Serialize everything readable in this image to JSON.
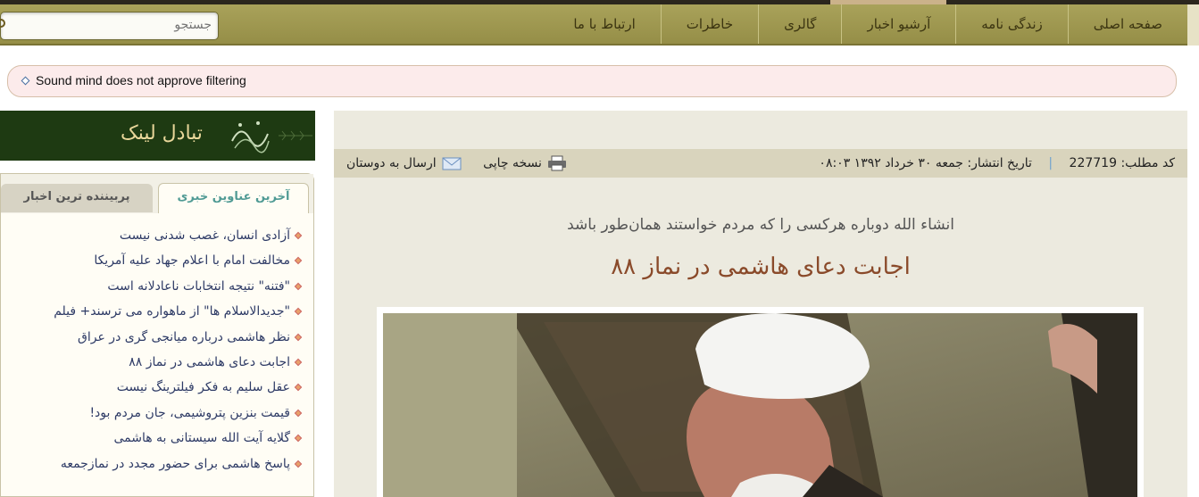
{
  "nav": {
    "items": [
      "صفحه اصلی",
      "زندگی نامه",
      "آرشیو اخبار",
      "گالری",
      "خاطرات",
      "ارتباط با ما"
    ],
    "search_placeholder": "جستجو"
  },
  "banner": {
    "text": "Sound mind does not approve filtering"
  },
  "sidebar": {
    "link_banner_title": "تبادل لینک",
    "tabs": {
      "active": "آخرین عناوین خبری",
      "inactive": "پربیننده ترین اخبار"
    },
    "news": [
      "آزادی انسان، غصب شدنی نیست",
      "مخالفت امام با اعلام جهاد علیه آمریکا",
      "\"فتنه\" نتیجه انتخابات ناعادلانه است",
      "\"جدیدالاسلام ها\" از ماهواره می ترسند+ فیلم",
      "نظر هاشمی درباره میانجی گری در عراق",
      "اجابت دعای هاشمی در نماز ۸۸",
      "عقل سلیم به فکر فیلترینگ نیست",
      "قیمت بنزین پتروشیمی، جان مردم بود!",
      "گلایه آیت الله سیستانی به هاشمی",
      "پاسخ هاشمی برای حضور مجدد در نمازجمعه"
    ]
  },
  "article": {
    "code_label": "کد مطلب:",
    "code_value": "227719",
    "date_label": "تاریخ انتشار:",
    "date_value": "جمعه ۳۰ خرداد ۱۳۹۲ ۰۸:۰۳",
    "print_label": "نسخه چاپی",
    "send_label": "ارسال به دوستان",
    "subtitle": "انشاء الله دوباره هرکسی را که مردم خواستند همان‌طور باشد",
    "title": "اجابت دعای هاشمی در نماز ۸۸"
  },
  "colors": {
    "navbar": "#a9a25a",
    "nav_text": "#3b3410",
    "banner_bg": "#fcebeb",
    "sidebar_link_text": "#2e3b66",
    "active_tab_text": "#4f9a94",
    "title_text": "#8a4a2a",
    "meta_bar": "#d9d4bd"
  },
  "icons": {
    "search": "search-icon",
    "print": "printer-icon",
    "send": "envelope-icon",
    "bullet": "diamond-bullet-icon"
  }
}
